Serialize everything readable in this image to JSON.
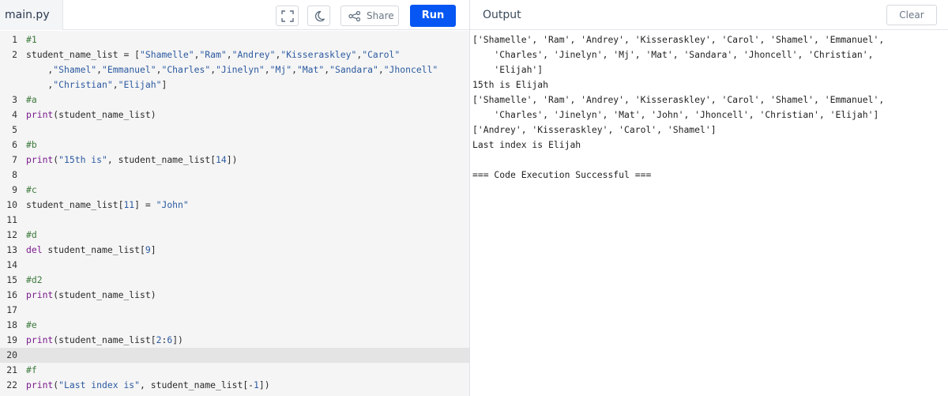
{
  "editor": {
    "file_name": "main.py",
    "run_label": "Run",
    "share_label": "Share",
    "active_line": 20,
    "lines": [
      {
        "num": "1",
        "tokens": [
          {
            "t": "#1",
            "c": "cm"
          }
        ]
      },
      {
        "num": "2",
        "tokens": [
          {
            "t": "student_name_list = [",
            "c": "plain"
          },
          {
            "t": "\"Shamelle\"",
            "c": "str"
          },
          {
            "t": ",",
            "c": "plain"
          },
          {
            "t": "\"Ram\"",
            "c": "str"
          },
          {
            "t": ",",
            "c": "plain"
          },
          {
            "t": "\"Andrey\"",
            "c": "str"
          },
          {
            "t": ",",
            "c": "plain"
          },
          {
            "t": "\"Kisseraskley\"",
            "c": "str"
          },
          {
            "t": ",",
            "c": "plain"
          },
          {
            "t": "\"Carol\"",
            "c": "str"
          }
        ]
      },
      {
        "num": "",
        "tokens": [
          {
            "t": "    ,",
            "c": "plain"
          },
          {
            "t": "\"Shamel\"",
            "c": "str"
          },
          {
            "t": ",",
            "c": "plain"
          },
          {
            "t": "\"Emmanuel\"",
            "c": "str"
          },
          {
            "t": ",",
            "c": "plain"
          },
          {
            "t": "\"Charles\"",
            "c": "str"
          },
          {
            "t": ",",
            "c": "plain"
          },
          {
            "t": "\"Jinelyn\"",
            "c": "str"
          },
          {
            "t": ",",
            "c": "plain"
          },
          {
            "t": "\"Mj\"",
            "c": "str"
          },
          {
            "t": ",",
            "c": "plain"
          },
          {
            "t": "\"Mat\"",
            "c": "str"
          },
          {
            "t": ",",
            "c": "plain"
          },
          {
            "t": "\"Sandara\"",
            "c": "str"
          },
          {
            "t": ",",
            "c": "plain"
          },
          {
            "t": "\"Jhoncell\"",
            "c": "str"
          }
        ]
      },
      {
        "num": "",
        "tokens": [
          {
            "t": "    ,",
            "c": "plain"
          },
          {
            "t": "\"Christian\"",
            "c": "str"
          },
          {
            "t": ",",
            "c": "plain"
          },
          {
            "t": "\"Elijah\"",
            "c": "str"
          },
          {
            "t": "]",
            "c": "plain"
          }
        ]
      },
      {
        "num": "3",
        "tokens": [
          {
            "t": "#a",
            "c": "cm"
          }
        ]
      },
      {
        "num": "4",
        "tokens": [
          {
            "t": "print",
            "c": "fn"
          },
          {
            "t": "(student_name_list)",
            "c": "plain"
          }
        ]
      },
      {
        "num": "5",
        "tokens": []
      },
      {
        "num": "6",
        "tokens": [
          {
            "t": "#b",
            "c": "cm"
          }
        ]
      },
      {
        "num": "7",
        "tokens": [
          {
            "t": "print",
            "c": "fn"
          },
          {
            "t": "(",
            "c": "plain"
          },
          {
            "t": "\"15th is\"",
            "c": "str"
          },
          {
            "t": ", student_name_list[",
            "c": "plain"
          },
          {
            "t": "14",
            "c": "num"
          },
          {
            "t": "])",
            "c": "plain"
          }
        ]
      },
      {
        "num": "8",
        "tokens": []
      },
      {
        "num": "9",
        "tokens": [
          {
            "t": "#c",
            "c": "cm"
          }
        ]
      },
      {
        "num": "10",
        "tokens": [
          {
            "t": "student_name_list[",
            "c": "plain"
          },
          {
            "t": "11",
            "c": "num"
          },
          {
            "t": "] = ",
            "c": "plain"
          },
          {
            "t": "\"John\"",
            "c": "str"
          }
        ]
      },
      {
        "num": "11",
        "tokens": []
      },
      {
        "num": "12",
        "tokens": [
          {
            "t": "#d",
            "c": "cm"
          }
        ]
      },
      {
        "num": "13",
        "tokens": [
          {
            "t": "del",
            "c": "kw"
          },
          {
            "t": " student_name_list[",
            "c": "plain"
          },
          {
            "t": "9",
            "c": "num"
          },
          {
            "t": "]",
            "c": "plain"
          }
        ]
      },
      {
        "num": "14",
        "tokens": []
      },
      {
        "num": "15",
        "tokens": [
          {
            "t": "#d2",
            "c": "cm"
          }
        ]
      },
      {
        "num": "16",
        "tokens": [
          {
            "t": "print",
            "c": "fn"
          },
          {
            "t": "(student_name_list)",
            "c": "plain"
          }
        ]
      },
      {
        "num": "17",
        "tokens": []
      },
      {
        "num": "18",
        "tokens": [
          {
            "t": "#e",
            "c": "cm"
          }
        ]
      },
      {
        "num": "19",
        "tokens": [
          {
            "t": "print",
            "c": "fn"
          },
          {
            "t": "(student_name_list[",
            "c": "plain"
          },
          {
            "t": "2",
            "c": "num"
          },
          {
            "t": ":",
            "c": "plain"
          },
          {
            "t": "6",
            "c": "num"
          },
          {
            "t": "])",
            "c": "plain"
          }
        ]
      },
      {
        "num": "20",
        "tokens": []
      },
      {
        "num": "21",
        "tokens": [
          {
            "t": "#f",
            "c": "cm"
          }
        ]
      },
      {
        "num": "22",
        "tokens": [
          {
            "t": "print",
            "c": "fn"
          },
          {
            "t": "(",
            "c": "plain"
          },
          {
            "t": "\"Last index is\"",
            "c": "str"
          },
          {
            "t": ", student_name_list[-",
            "c": "plain"
          },
          {
            "t": "1",
            "c": "num"
          },
          {
            "t": "])",
            "c": "plain"
          }
        ]
      }
    ]
  },
  "output": {
    "title": "Output",
    "clear_label": "Clear",
    "lines": [
      "['Shamelle', 'Ram', 'Andrey', 'Kisseraskley', 'Carol', 'Shamel', 'Emmanuel',",
      "    'Charles', 'Jinelyn', 'Mj', 'Mat', 'Sandara', 'Jhoncell', 'Christian',",
      "    'Elijah']",
      "15th is Elijah",
      "['Shamelle', 'Ram', 'Andrey', 'Kisseraskley', 'Carol', 'Shamel', 'Emmanuel',",
      "    'Charles', 'Jinelyn', 'Mat', 'John', 'Jhoncell', 'Christian', 'Elijah']",
      "['Andrey', 'Kisseraskley', 'Carol', 'Shamel']",
      "Last index is Elijah",
      "",
      "=== Code Execution Successful ==="
    ]
  },
  "icons": {
    "fullscreen": "fullscreen-icon",
    "theme": "moon-icon",
    "share": "share-icon"
  },
  "colors": {
    "run_button": "#0556f3",
    "editor_bg": "#f5f5f5",
    "active_line_bg": "#e4e4e4"
  }
}
